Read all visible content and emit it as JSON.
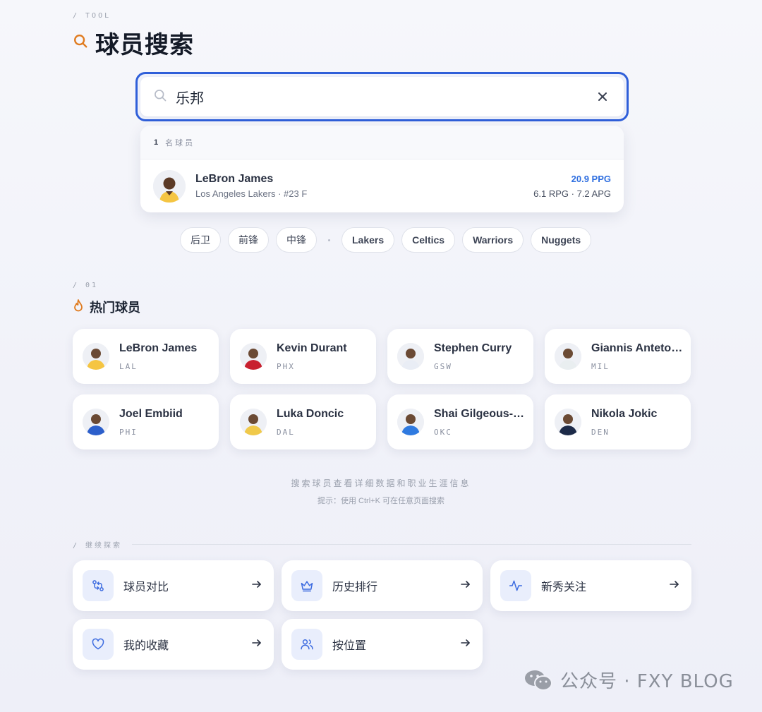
{
  "header": {
    "eyebrow": "/ TOOL",
    "title": "球员搜索"
  },
  "search": {
    "value": "乐邦",
    "placeholder": ""
  },
  "results": {
    "count": "1",
    "count_label": "名球员",
    "items": [
      {
        "name": "LeBron James",
        "sub": "Los Angeles Lakers · #23 F",
        "ppg": "20.9 PPG",
        "rest": "6.1 RPG · 7.2 APG"
      }
    ]
  },
  "filters": {
    "positions": [
      "后卫",
      "前锋",
      "中锋"
    ],
    "teams": [
      "Lakers",
      "Celtics",
      "Warriors",
      "Nuggets"
    ]
  },
  "popular": {
    "eyebrow": "/ 01",
    "title": "热门球员",
    "players": [
      {
        "name": "LeBron James",
        "team": "LAL",
        "jersey": "#f5c542"
      },
      {
        "name": "Kevin Durant",
        "team": "PHX",
        "jersey": "#c8202f"
      },
      {
        "name": "Stephen Curry",
        "team": "GSW",
        "jersey": "#e9edf5"
      },
      {
        "name": "Giannis Antetokounmpo",
        "team": "MIL",
        "jersey": "#e9eef0"
      },
      {
        "name": "Joel Embiid",
        "team": "PHI",
        "jersey": "#2c5fcb"
      },
      {
        "name": "Luka Doncic",
        "team": "DAL",
        "jersey": "#f0c94a"
      },
      {
        "name": "Shai Gilgeous-Alexander",
        "team": "OKC",
        "jersey": "#2f7ae0"
      },
      {
        "name": "Nikola Jokic",
        "team": "DEN",
        "jersey": "#1c2a48"
      }
    ]
  },
  "hint": {
    "line1": "搜索球员查看详细数据和职业生涯信息",
    "line2": "提示：使用 Ctrl+K 可在任意页面搜索"
  },
  "explore": {
    "eyebrow": "/ 继续探索",
    "items": [
      {
        "label": "球员对比",
        "icon": "compare-icon"
      },
      {
        "label": "历史排行",
        "icon": "crown-icon"
      },
      {
        "label": "新秀关注",
        "icon": "pulse-icon"
      },
      {
        "label": "我的收藏",
        "icon": "heart-icon"
      },
      {
        "label": "按位置",
        "icon": "users-icon"
      }
    ]
  },
  "watermark": "公众号 · FXY BLOG",
  "colors": {
    "accent": "#2f5fd9",
    "orange": "#e07b1f",
    "stat_blue": "#2f6fe0"
  }
}
